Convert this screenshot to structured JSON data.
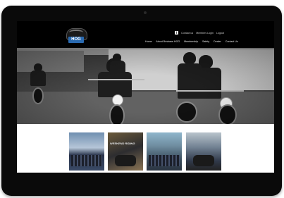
{
  "site": {
    "logo_text": "HOG",
    "utility": {
      "facebook_glyph": "f",
      "items": [
        "Contact us",
        "Members Login",
        "Logout"
      ]
    },
    "nav": [
      "Home",
      "About Brisbane HOG",
      "Membership",
      "Safety",
      "Dealer",
      "Contact Us"
    ]
  },
  "gallery": {
    "thumbs": [
      {
        "caption": ""
      },
      {
        "caption": "WEEKEND RIDING"
      },
      {
        "caption": ""
      },
      {
        "caption": ""
      }
    ]
  },
  "colors": {
    "bezel": "#0a0a0a",
    "header_bg": "#000000",
    "hog_blue": "#2a6ab0",
    "content_bg": "#ffffff"
  },
  "icons": [
    "facebook-icon",
    "envelope-icon",
    "user-icon",
    "logout-icon",
    "camera-icon"
  ]
}
